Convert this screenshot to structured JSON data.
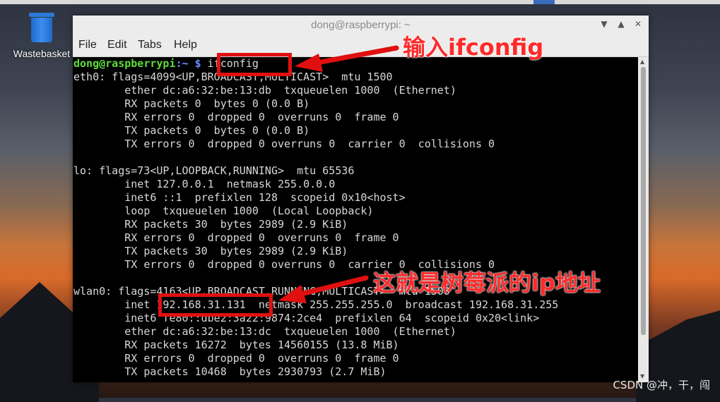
{
  "desktop": {
    "wastebasket_label": "Wastebasket",
    "watermark": "CSDN @冲，干，闯"
  },
  "window": {
    "title": "dong@raspberrypi: ~",
    "menu": [
      "File",
      "Edit",
      "Tabs",
      "Help"
    ]
  },
  "terminal": {
    "prompt_user": "dong@raspberrypi",
    "prompt_path": ":~ $ ",
    "command": "ifconfig",
    "output": [
      "eth0: flags=4099<UP,BROADCAST,MULTICAST>  mtu 1500",
      "        ether dc:a6:32:be:13:db  txqueuelen 1000  (Ethernet)",
      "        RX packets 0  bytes 0 (0.0 B)",
      "        RX errors 0  dropped 0  overruns 0  frame 0",
      "        TX packets 0  bytes 0 (0.0 B)",
      "        TX errors 0  dropped 0 overruns 0  carrier 0  collisions 0",
      "",
      "lo: flags=73<UP,LOOPBACK,RUNNING>  mtu 65536",
      "        inet 127.0.0.1  netmask 255.0.0.0",
      "        inet6 ::1  prefixlen 128  scopeid 0x10<host>",
      "        loop  txqueuelen 1000  (Local Loopback)",
      "        RX packets 30  bytes 2989 (2.9 KiB)",
      "        RX errors 0  dropped 0  overruns 0  frame 0",
      "        TX packets 30  bytes 2989 (2.9 KiB)",
      "        TX errors 0  dropped 0 overruns 0  carrier 0  collisions 0",
      "",
      "wlan0: flags=4163<UP,BROADCAST,RUNNING,MULTICAST>  mtu 1500",
      "        inet 192.168.31.131  netmask 255.255.255.0  broadcast 192.168.31.255",
      "        inet6 fe80::dbe2:3a22:9874:2ce4  prefixlen 64  scopeid 0x20<link>",
      "        ether dc:a6:32:be:13:dc  txqueuelen 1000  (Ethernet)",
      "        RX packets 16272  bytes 14560155 (13.8 MiB)",
      "        RX errors 0  dropped 0  overruns 0  frame 0",
      "        TX packets 10468  bytes 2930793 (2.7 MiB)"
    ]
  },
  "annotations": {
    "input_label": "输入ifconfig",
    "ip_label": "这就是树莓派的ip地址",
    "color": "#e01010"
  }
}
